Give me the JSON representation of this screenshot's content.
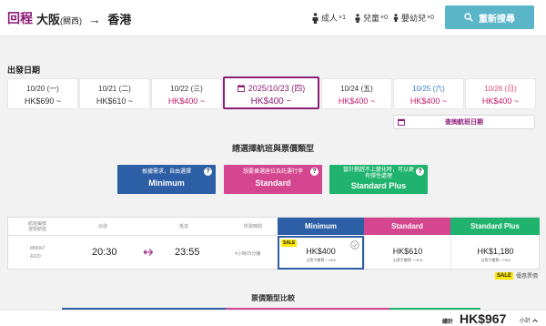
{
  "header": {
    "return_label": "回程",
    "origin": "大阪",
    "origin_airport": "(關西)",
    "arrow": "→",
    "destination": "香港",
    "passengers": [
      {
        "icon": "adult-icon",
        "label": "成人",
        "count": "×1"
      },
      {
        "icon": "child-icon",
        "label": "兒童",
        "count": "×0"
      },
      {
        "icon": "infant-icon",
        "label": "嬰幼兒",
        "count": "×0"
      }
    ],
    "search_button": "重新搜尋"
  },
  "dates": {
    "section_label": "出發日期",
    "items": [
      {
        "date": "10/20 (一)",
        "price": "HK$690 ~"
      },
      {
        "date": "10/21 (二)",
        "price": "HK$610 ~"
      },
      {
        "date": "10/22 (三)",
        "price": "HK$400 ~"
      },
      {
        "date": "2025/10/23 (四)",
        "price": "HK$400 ~",
        "selected": true
      },
      {
        "date": "10/24 (五)",
        "price": "HK$400 ~"
      },
      {
        "date": "10/25 (六)",
        "price": "HK$400 ~"
      },
      {
        "date": "10/26 (日)",
        "price": "HK$400 ~"
      }
    ],
    "more_dates": "查詢航班日期"
  },
  "fare_types": {
    "title": "請選擇航班與票價類型",
    "items": [
      {
        "desc": "根據需求，自由選擇",
        "name": "Minimum"
      },
      {
        "desc": "想要揀選座位及託運行李",
        "name": "Standard"
      },
      {
        "desc": "當計劃趕不上變化時，可以更有彈性處理",
        "name": "Standard Plus"
      }
    ]
  },
  "flight_table": {
    "headers": {
      "flight": "航班編號\n運營航班",
      "depart": "出發",
      "arrive": "抵達",
      "duration": "所需時間"
    },
    "fare_headers": [
      "Minimum",
      "Standard",
      "Standard Plus"
    ],
    "row": {
      "flight_no": "MM067",
      "aircraft": "A320",
      "depart_time": "20:30",
      "arrive_time": "23:55",
      "duration": "4小時25分鐘",
      "fares": [
        {
          "sale": "SALE",
          "amount": "HK$400",
          "sub": "出票手續費 + HK$"
        },
        {
          "amount": "HK$610",
          "sub": "出票手續費 + HK$"
        },
        {
          "amount": "HK$1,180",
          "sub": "出票手續費 + HK$"
        }
      ]
    }
  },
  "legend": {
    "tag": "SALE",
    "text": "優惠票價"
  },
  "compare_title": "票價類型比較",
  "footer": {
    "total_label": "總計",
    "total_value": "HK$967",
    "subtotal": "小計"
  },
  "colors": {
    "brand": "#8b1c77",
    "minimum": "#2d5fa6",
    "standard": "#d4468f",
    "standard_plus": "#1fb36e",
    "search_button": "#5ab5c9",
    "sale": "#ffe600"
  }
}
